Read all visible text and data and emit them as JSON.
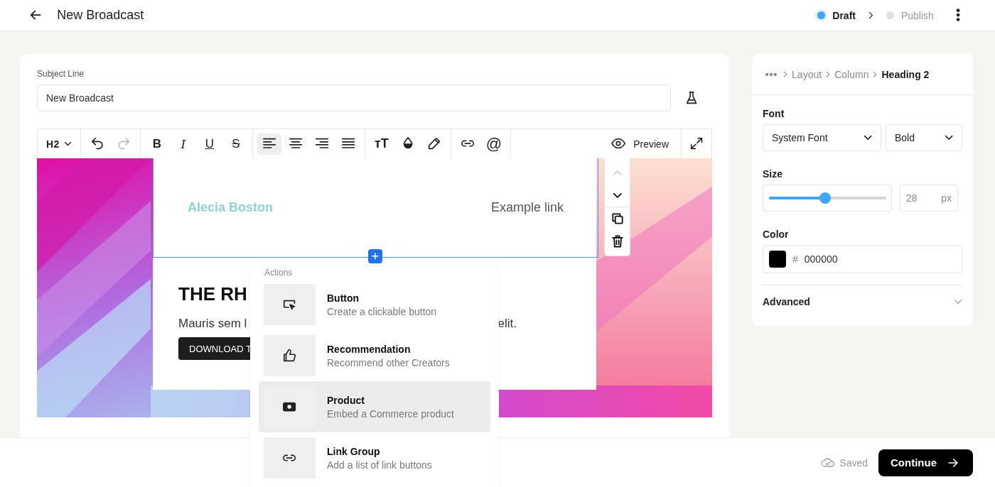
{
  "header": {
    "title": "New Broadcast",
    "steps": [
      {
        "label": "Draft",
        "selected": true
      },
      {
        "label": "Publish",
        "selected": false
      }
    ]
  },
  "editor": {
    "subject": {
      "label": "Subject Line",
      "value": "New Broadcast"
    },
    "toolbar": {
      "groups": [
        {
          "items": [
            {
              "kind": "heading",
              "label": "H2"
            }
          ]
        },
        {
          "items": [
            {
              "kind": "undo",
              "disabled": false
            },
            {
              "kind": "redo",
              "disabled": true
            }
          ]
        },
        {
          "items": [
            {
              "kind": "bold",
              "label": "B"
            },
            {
              "kind": "italic",
              "label": "I"
            },
            {
              "kind": "underline",
              "label": "U"
            },
            {
              "kind": "strike",
              "label": "S"
            }
          ]
        },
        {
          "items": [
            {
              "kind": "align-left",
              "selected": true
            },
            {
              "kind": "align-center",
              "selected": false
            },
            {
              "kind": "align-right",
              "selected": false
            },
            {
              "kind": "align-justify",
              "selected": false
            }
          ]
        },
        {
          "items": [
            {
              "kind": "size",
              "label": "тT"
            },
            {
              "kind": "color"
            },
            {
              "kind": "highlight"
            }
          ]
        },
        {
          "items": [
            {
              "kind": "link"
            },
            {
              "kind": "mention",
              "label": "@"
            }
          ]
        }
      ],
      "preview": "Preview"
    },
    "email": {
      "name": "Alecia Boston",
      "link": "Example link",
      "heading": "THE RH",
      "body_start": "Mauris sem l",
      "body_end": "elit.",
      "cta": "DOWNLOAD T"
    },
    "block_tools": [
      {
        "kind": "up",
        "disabled": true
      },
      {
        "kind": "down",
        "disabled": false
      },
      {
        "kind": "duplicate",
        "disabled": false
      },
      {
        "kind": "delete",
        "disabled": false
      }
    ]
  },
  "insert_menu": {
    "heading": "Actions",
    "items": [
      {
        "kind": "button",
        "title": "Button",
        "description": "Create a clickable button",
        "highlighted": false
      },
      {
        "kind": "recommendation",
        "title": "Recommendation",
        "description": "Recommend other Creators",
        "highlighted": false
      },
      {
        "kind": "product",
        "title": "Product",
        "description": "Embed a Commerce product",
        "highlighted": true
      },
      {
        "kind": "link-group",
        "title": "Link Group",
        "description": "Add a list of link buttons",
        "highlighted": false
      }
    ]
  },
  "panel": {
    "breadcrumb": [
      {
        "label": "Layout",
        "selected": false
      },
      {
        "label": "Column",
        "selected": false
      },
      {
        "label": "Heading 2",
        "selected": true
      }
    ],
    "font": {
      "label": "Font",
      "family": "System Font",
      "weight": "Bold"
    },
    "size": {
      "label": "Size",
      "level": 0.48,
      "value": "28",
      "unit": "px"
    },
    "color": {
      "label": "Color",
      "color": "#000000",
      "hash": "#",
      "value": "000000"
    },
    "advanced": {
      "label": "Advanced",
      "expanded": false
    }
  },
  "footer": {
    "status": "Saved",
    "action": "Continue"
  }
}
